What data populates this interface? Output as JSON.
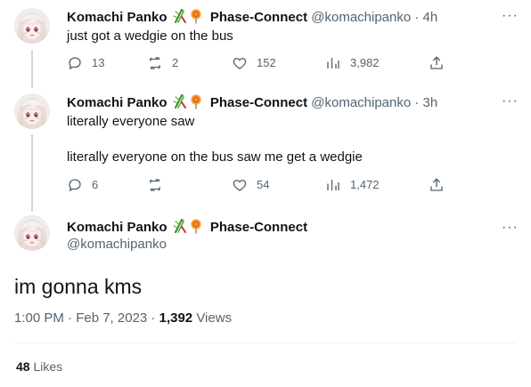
{
  "author": {
    "name": "Komachi Panko",
    "affiliation": "Phase-Connect",
    "handle": "@komachipanko"
  },
  "icons": {
    "reply": "reply-icon",
    "retweet": "retweet-icon",
    "like": "heart-icon",
    "views": "views-icon",
    "share": "share-icon",
    "more": "more-icon",
    "emoji": "bamboo-and-lollipop-emoji"
  },
  "tweets": [
    {
      "time": "4h",
      "text": "just got a wedgie on the bus",
      "replies": "13",
      "retweets": "2",
      "likes": "152",
      "views": "3,982"
    },
    {
      "time": "3h",
      "text_line1": "literally everyone saw",
      "text_line2": "literally everyone on the bus saw me get a wedgie",
      "replies": "6",
      "retweets": "",
      "likes": "54",
      "views": "1,472"
    }
  ],
  "main_tweet": {
    "text": "im gonna kms",
    "timestamp": "1:00 PM · Feb 7, 2023",
    "separator": " · ",
    "views_count": "1,392",
    "views_label": " Views",
    "likes_count": "48",
    "likes_label": " Likes"
  },
  "more_glyph": "···",
  "dot": "·",
  "colors": {
    "text_primary": "#0f1419",
    "text_secondary": "#536471",
    "thread_line": "#cfd9de",
    "divider": "#eff3f4"
  }
}
